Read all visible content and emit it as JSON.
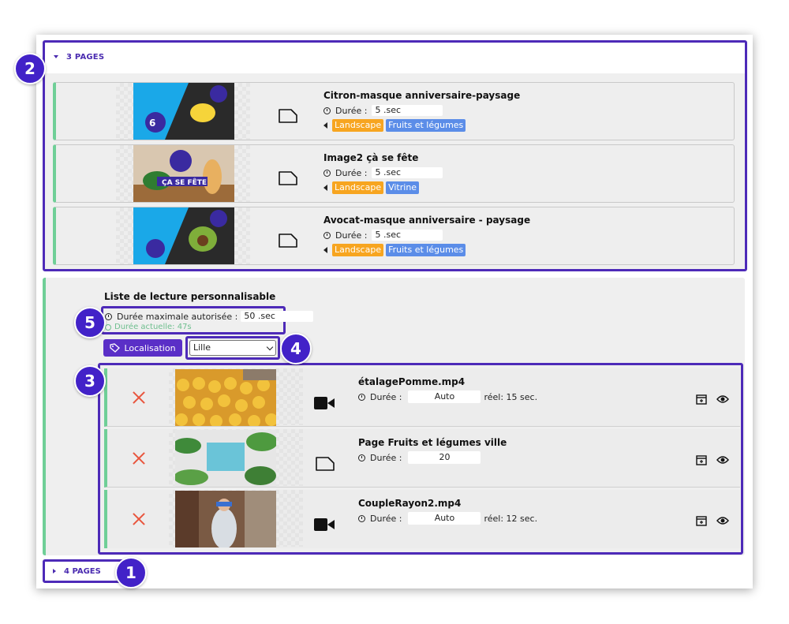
{
  "colors": {
    "accent": "#4d2ab8",
    "green": "#6fcf97",
    "orange_tag": "#f7a520",
    "blue_tag": "#5b8de8",
    "delete": "#e8553d"
  },
  "section_pages": {
    "label": "3 PAGES",
    "items": [
      {
        "title": "Citron-masque anniversaire-paysage",
        "duration_label": "Durée :",
        "duration_value": "5 .sec",
        "tags": [
          "Landscape",
          "Fruits et légumes"
        ]
      },
      {
        "title": "Image2 çà se fête",
        "duration_label": "Durée :",
        "duration_value": "5 .sec",
        "tags": [
          "Landscape",
          "Vitrine"
        ]
      },
      {
        "title": "Avocat-masque anniversaire - paysage",
        "duration_label": "Durée :",
        "duration_value": "5 .sec",
        "tags": [
          "Landscape",
          "Fruits et légumes"
        ]
      }
    ]
  },
  "playlist": {
    "title": "Liste de lecture personnalisable",
    "max_label": "Durée maximale autorisée :",
    "max_value": "50 .sec",
    "current": "Durée actuelle: 47s",
    "location_button": "Localisation",
    "location_select": "Lille",
    "items": [
      {
        "title": "étalagePomme.mp4",
        "type": "video",
        "duration_label": "Durée :",
        "duration_value": "Auto",
        "real": "réel: 15 sec."
      },
      {
        "title": "Page Fruits et légumes ville",
        "type": "page",
        "duration_label": "Durée :",
        "duration_value": "20",
        "real": ""
      },
      {
        "title": "CoupleRayon2.mp4",
        "type": "video",
        "duration_label": "Durée :",
        "duration_value": "Auto",
        "real": "réel: 12 sec."
      }
    ]
  },
  "footer_section": {
    "label": "4 PAGES"
  },
  "badges": [
    "1",
    "2",
    "3",
    "4",
    "5"
  ],
  "icons": [
    "caret-down-icon",
    "caret-right-icon",
    "page-icon",
    "clock-icon",
    "tag-icon",
    "delete-icon",
    "video-camera-icon",
    "calendar-add-icon",
    "eye-icon",
    "chevron-down-icon"
  ]
}
